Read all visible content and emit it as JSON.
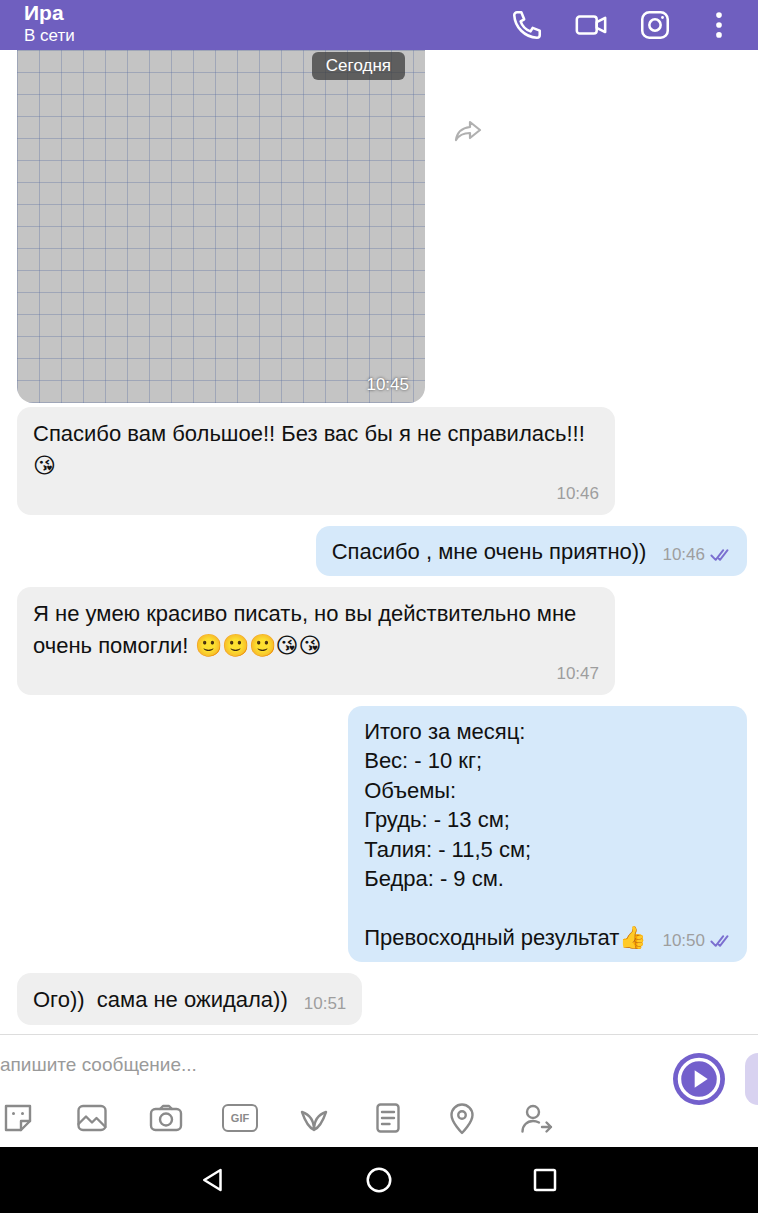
{
  "header": {
    "title": "Ира",
    "status": "В сети"
  },
  "messages": [
    {
      "kind": "image",
      "date_badge": "Сегодня",
      "time": "10:45"
    },
    {
      "kind": "incoming",
      "text": "Спасибо вам большое!! Без вас бы я не справилась!!! 😘",
      "time": "10:46"
    },
    {
      "kind": "outgoing",
      "text": "Спасибо , мне очень приятно))",
      "time": "10:46",
      "read": true
    },
    {
      "kind": "incoming",
      "text": "Я не умею красиво писать, но вы действительно мне очень помогли! 🙂🙂🙂😘😘",
      "time": "10:47"
    },
    {
      "kind": "outgoing",
      "text": "Итого за месяц:\nВес: - 10 кг;\nОбъемы:\nГрудь: - 13 см;\nТалия: - 11,5 см;\nБедра: - 9 см.\n\nПревосходный результат👍",
      "time": "10:50",
      "read": true
    },
    {
      "kind": "incoming",
      "text": "Ого))  сама не ожидала))",
      "time": "10:51"
    }
  ],
  "composer": {
    "placeholder": "апишите сообщение...",
    "gif_label": "GIF"
  }
}
